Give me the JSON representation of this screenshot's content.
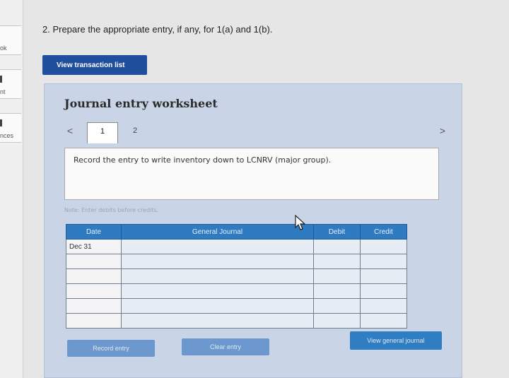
{
  "rail": {
    "items": [
      {
        "label": "ok"
      },
      {
        "label": "nt"
      },
      {
        "label": "nces"
      }
    ]
  },
  "question": {
    "text": "2. Prepare the appropriate entry, if any, for 1(a) and 1(b)."
  },
  "toolbar": {
    "view_transaction_list": "View transaction list"
  },
  "worksheet": {
    "title": "Journal entry worksheet",
    "prev_symbol": "<",
    "next_symbol": ">",
    "tabs": [
      {
        "label": "1",
        "active": true
      },
      {
        "label": "2",
        "active": false
      }
    ],
    "instruction": "Record the entry to write inventory down to LCNRV (major group).",
    "note": "Note: Enter debits before credits.",
    "table": {
      "headers": [
        "Date",
        "General Journal",
        "Debit",
        "Credit"
      ],
      "rows": [
        [
          "Dec 31",
          "",
          "",
          ""
        ],
        [
          "",
          "",
          "",
          ""
        ],
        [
          "",
          "",
          "",
          ""
        ],
        [
          "",
          "",
          "",
          ""
        ],
        [
          "",
          "",
          "",
          ""
        ],
        [
          "",
          "",
          "",
          ""
        ]
      ]
    },
    "buttons": {
      "record": "Record entry",
      "clear": "Clear entry",
      "view_general_journal": "View general journal"
    }
  },
  "colors": {
    "primary_button": "#1f4e9c",
    "table_header": "#2e7bc1",
    "worksheet_bg": "#c9d5e6"
  }
}
